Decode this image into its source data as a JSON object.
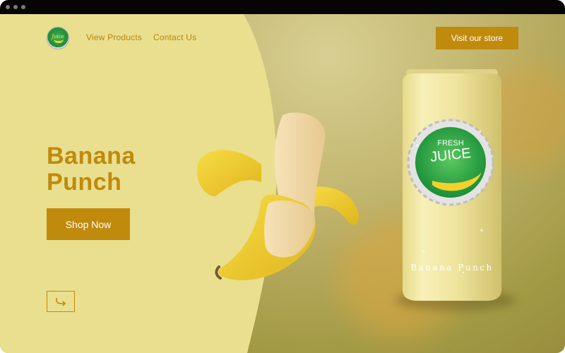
{
  "window": {
    "titlebar_dots": [
      "window-dot",
      "window-dot",
      "window-dot"
    ]
  },
  "nav": {
    "logo_text": "Juice",
    "links": [
      "View Products",
      "Contact Us"
    ],
    "cta": "Visit our store"
  },
  "hero": {
    "title_line1": "Banana",
    "title_line2": "Punch",
    "button": "Shop Now",
    "arrow_icon": "arrow-down-right-icon"
  },
  "product": {
    "can_label": "Banana Punch",
    "cap_line1": "FRESH",
    "cap_line2": "JUICE"
  },
  "colors": {
    "accent": "#c08a0c",
    "panel_left": "#e9df8f",
    "background_right": "#a39a45",
    "titlebar": "#050505"
  }
}
